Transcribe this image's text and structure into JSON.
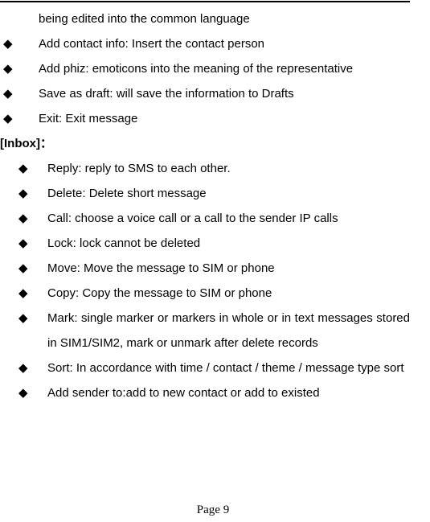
{
  "document": {
    "type": "user-manual-page",
    "has_header_rule": true,
    "text_color": "#000000",
    "background_color": "#ffffff"
  },
  "continuation": {
    "text": "being edited into the common language"
  },
  "bullet_glyph": "◆",
  "compose_list": {
    "items": [
      {
        "text": "Add contact info: Insert the contact person"
      },
      {
        "text": "Add phiz: emoticons into the meaning of the representative"
      },
      {
        "text": "Save as draft: will save the information to Drafts"
      },
      {
        "text": "Exit: Exit message"
      }
    ]
  },
  "inbox_section": {
    "heading": "[Inbox]：",
    "items": [
      {
        "text": "Reply: reply to SMS to each other."
      },
      {
        "text": "Delete: Delete short message"
      },
      {
        "text": "Call: choose a voice call or a call to the sender IP calls"
      },
      {
        "text": "Lock: lock cannot be deleted"
      },
      {
        "text": "Move: Move the message to SIM or phone"
      },
      {
        "text": "Copy: Copy the message to SIM or phone"
      },
      {
        "text": "Mark: single marker or markers in whole or in text messages stored in SIM1/SIM2, mark or unmark after delete records"
      },
      {
        "text": "Sort: In accordance with time / contact / theme / message type sort"
      },
      {
        "text": "Add sender to:add to new contact or add to existed"
      }
    ]
  },
  "footer": {
    "page_label": "Page 9"
  }
}
